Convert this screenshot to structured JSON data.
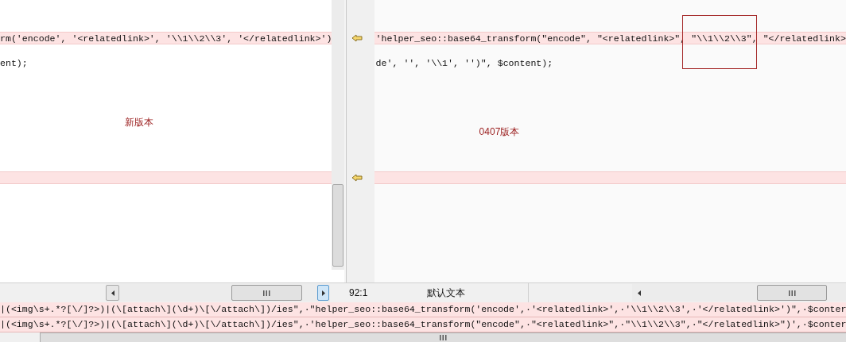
{
  "left_pane": {
    "annotation": "新版本",
    "lines": [
      {
        "kind": "line",
        "text": "rm('encode', '<relatedlink>', '\\\\1\\\\2\\\\3', '</relatedlink>')",
        "changed": true
      },
      {
        "kind": "blank"
      },
      {
        "kind": "line",
        "text": "ent);",
        "changed": false
      },
      {
        "kind": "blank"
      },
      {
        "kind": "blank"
      },
      {
        "kind": "blank"
      },
      {
        "kind": "blank"
      },
      {
        "kind": "blank"
      },
      {
        "kind": "blank"
      },
      {
        "kind": "blank"
      },
      {
        "kind": "blank"
      },
      {
        "kind": "line",
        "changed": true
      }
    ]
  },
  "right_pane": {
    "annotation": "0407版本",
    "lines": [
      {
        "kind": "line",
        "text": "'helper_seo::base64_transform(\"encode\", \"<relatedlink>\", \"\\\\1\\\\2\\\\3\", \"</relatedlink>",
        "changed": true
      },
      {
        "kind": "blank"
      },
      {
        "kind": "line",
        "text": "de', '', '\\\\1', '')\", $content);",
        "changed": false
      },
      {
        "kind": "blank"
      },
      {
        "kind": "blank"
      },
      {
        "kind": "blank"
      },
      {
        "kind": "blank"
      },
      {
        "kind": "blank"
      },
      {
        "kind": "blank"
      },
      {
        "kind": "blank"
      },
      {
        "kind": "blank"
      },
      {
        "kind": "line",
        "changed": true
      }
    ]
  },
  "status_bar": {
    "position": "92:1",
    "syntax": "默认文本"
  },
  "compare_lines": [
    {
      "text": "|(<img\\s+.*?[\\/]?>)|(\\[attach\\](\\d+)\\[\\/attach\\])/ies\",·\"helper_seo::base64_transform('encode',·'<relatedlink>',·'\\\\1\\\\2\\\\3',·'</relatedlink>')\",·$conter",
      "changed": true
    },
    {
      "text": "|(<img\\s+.*?[\\/]?>)|(\\[attach\\](\\d+)\\[\\/attach\\])/ies\",·'helper_seo::base64_transform(\"encode\",·\"<relatedlink>\",·\"\\\\1\\\\2\\\\3\",·\"</relatedlink>\")',·$conter",
      "changed": true
    }
  ]
}
